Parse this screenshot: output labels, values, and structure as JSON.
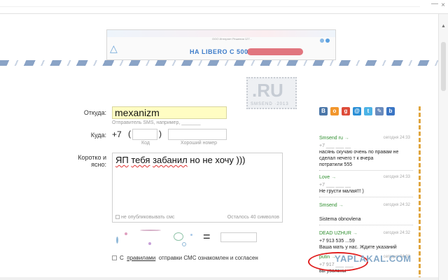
{
  "window": {
    "close_glyph": "×",
    "min_glyph": "—",
    "scroll_up": "▲"
  },
  "ad": {
    "small_text": "ООО Интернет Решения 127...",
    "main_text": "НА LIBERO С 500"
  },
  "stamp": {
    "brand": ".RU",
    "sub": "SMSEND ·2013"
  },
  "form": {
    "from": {
      "label": "Откуда:",
      "value": "mexanizm",
      "hint": "Отправитель SMS, например, _______"
    },
    "to": {
      "label": "Куда:",
      "prefix": "+7",
      "open_paren": "(",
      "close_paren": ")",
      "code_hint": "Код",
      "number_hint": "Хороший номер"
    },
    "message": {
      "label_line1": "Коротко и",
      "label_line2": "ясно:",
      "word1": "ЯП",
      "word2": "тебя",
      "word3": "забанил",
      "rest": " но не хочу )))",
      "no_publish": "не опубликовывать смс",
      "counter": "Осталось 40 символов"
    },
    "captcha": {
      "equals": "="
    },
    "agree": {
      "prefix": "С",
      "link": "правилами",
      "rest": "отправки СМС ознакомлен и согласен"
    }
  },
  "social": [
    {
      "name": "vk-icon",
      "glyph": "B",
      "color": "#4a76a8"
    },
    {
      "name": "odnoklassniki-icon",
      "glyph": "o",
      "color": "#f2962c"
    },
    {
      "name": "google-icon",
      "glyph": "g",
      "color": "#dd4b39"
    },
    {
      "name": "mail-icon",
      "glyph": "@",
      "color": "#2a8fd6"
    },
    {
      "name": "twitter-icon",
      "glyph": "t",
      "color": "#4cb3e6"
    },
    {
      "name": "livejournal-icon",
      "glyph": "✎",
      "color": "#6a8bbd"
    },
    {
      "name": "blogger-icon",
      "glyph": "b",
      "color": "#3a75c4"
    }
  ],
  "feed": [
    {
      "author": "Smsend ru",
      "arrow": "→",
      "time": "сегодня 24:33",
      "body_lines": [
        "+7 ___ ___ __",
        "насянь скучаю очень по правам не",
        "сделал нечего т к вчера",
        "потратили 555"
      ]
    },
    {
      "author": "Love",
      "arrow": "→",
      "time": "сегодня 24:33",
      "body_lines": [
        "+7 ___ ___ __",
        "Не грусти малая!!! )"
      ]
    },
    {
      "author": "Smsend",
      "arrow": "→",
      "time": "сегодня 24:32",
      "body_lines": [
        "",
        "Sistema obnovlena"
      ]
    },
    {
      "author": "DEAD UZHUR",
      "arrow": "→",
      "time": "сегодня 24:32",
      "body_lines": [
        "+7 913 535 ...59",
        "Ваша мать у нас. Ждите указаний"
      ]
    },
    {
      "author": "putin",
      "arrow": "→",
      "time": "сегодня 24:32",
      "body_lines": [
        "+7 917 ___ ___",
        "вы уволены"
      ]
    }
  ],
  "watermark": "YAPLAKAL.COM"
}
